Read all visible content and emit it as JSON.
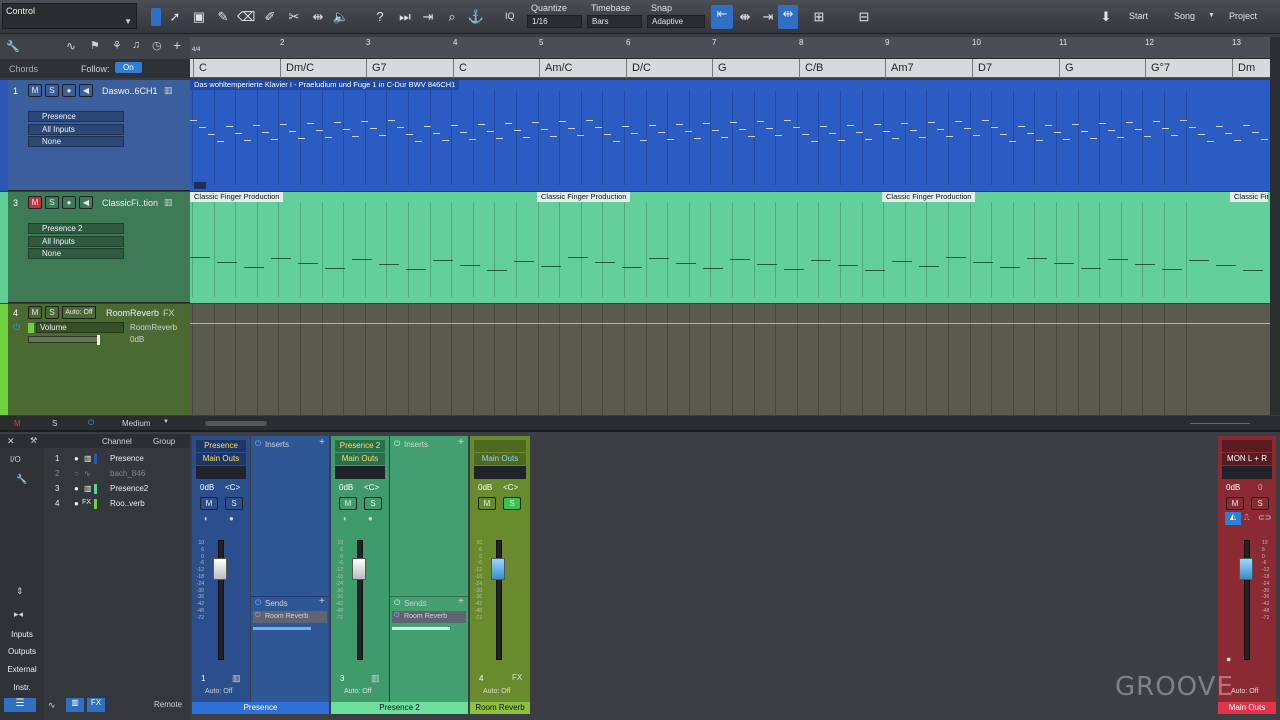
{
  "toolbar": {
    "control_label": "Control",
    "quantize_label": "Quantize",
    "quantize_value": "1/16",
    "timebase_label": "Timebase",
    "timebase_value": "Bars",
    "snap_label": "Snap",
    "snap_value": "Adaptive",
    "iq_label": "IQ",
    "start_label": "Start",
    "song_label": "Song",
    "project_label": "Project"
  },
  "ruler": {
    "numbers": [
      "2",
      "3",
      "4",
      "5",
      "6",
      "7",
      "8",
      "9",
      "10",
      "11",
      "12",
      "13"
    ],
    "sig": "4/4"
  },
  "chords": {
    "label": "Chords",
    "follow_label": "Follow:",
    "follow_value": "On",
    "items": [
      "C",
      "Dm/C",
      "G7",
      "C",
      "Am/C",
      "D/C",
      "G",
      "C/B",
      "Am7",
      "D7",
      "G",
      "G°7",
      "Dm"
    ]
  },
  "tracks": [
    {
      "num": "1",
      "name": "Daswo..6CH1",
      "instrument": "Presence",
      "input": "All Inputs",
      "output": "None",
      "clip": "Das wohltemperierte Klavier I - Praeludium und Fuge 1 in C-Dur BWV 846CH1"
    },
    {
      "num": "3",
      "name": "ClassicFi..tion",
      "instrument": "Presence 2",
      "input": "All Inputs",
      "output": "None",
      "clip": "Classic Finger Production"
    },
    {
      "num": "4",
      "name": "RoomReverb",
      "fx": "FX",
      "auto": "Auto: Off",
      "param": "Volume",
      "param_target": "RoomReverb",
      "param_value": "0dB"
    }
  ],
  "bottombar": {
    "m": "M",
    "s": "S",
    "zoom": "Medium"
  },
  "console": {
    "io": "I/O",
    "channel_header": "Channel",
    "group_header": "Group",
    "channels": [
      {
        "n": "1",
        "name": "Presence"
      },
      {
        "n": "2",
        "name": "bach_846"
      },
      {
        "n": "3",
        "name": "Presence2"
      },
      {
        "n": "4",
        "name": "Roo..verb"
      }
    ],
    "side": [
      "Inputs",
      "Outputs",
      "External",
      "Instr."
    ],
    "remote": "Remote",
    "strips": [
      {
        "name": "Presence",
        "out": "Main Outs",
        "db": "0dB",
        "pan": "<C>",
        "num": "1",
        "auto": "Auto: Off",
        "inserts": "Inserts",
        "sends": "Sends",
        "send": "Room Reverb",
        "footer": "Presence"
      },
      {
        "name": "Presence 2",
        "out": "Main Outs",
        "db": "0dB",
        "pan": "<C>",
        "num": "3",
        "auto": "Auto: Off",
        "inserts": "Inserts",
        "sends": "Sends",
        "send": "Room Reverb",
        "footer": "Presence 2"
      },
      {
        "name": "",
        "out": "Main Outs",
        "db": "0dB",
        "pan": "<C>",
        "num": "4",
        "auto": "Auto: Off",
        "fx": "FX",
        "footer": "Room Reverb"
      },
      {
        "name": "MON L + R",
        "db": "0dB",
        "pan": "0",
        "auto": "Auto: Off",
        "footer": "Main Outs"
      }
    ],
    "scale": [
      "10",
      "6",
      "0",
      "-6",
      "-12",
      "-18",
      "-24",
      "-30",
      "-36",
      "-42",
      "-48",
      "-72"
    ]
  },
  "watermark": "GROOVE",
  "colors": {
    "blue": "#2f5fbf",
    "green": "#5fcf98",
    "reverb": "#5b5a4f",
    "accent": "#2f7fd8",
    "red": "#c8323c"
  }
}
